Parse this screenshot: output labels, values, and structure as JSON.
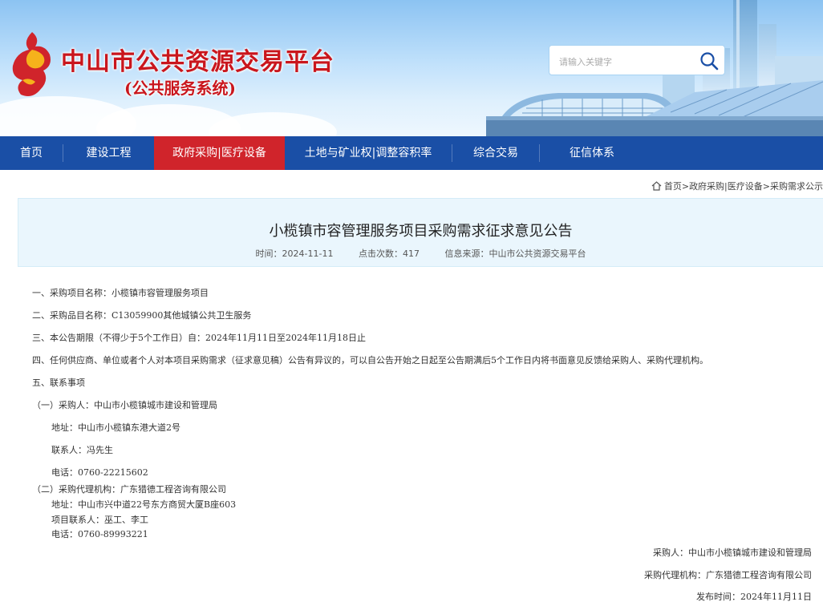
{
  "header": {
    "title": "中山市公共资源交易平台",
    "subtitle": "(公共服务系统)",
    "search_placeholder": "请输入关键字"
  },
  "nav": {
    "items": [
      {
        "label": "首页"
      },
      {
        "label": "建设工程"
      },
      {
        "label": "政府采购|医疗设备"
      },
      {
        "label": "土地与矿业权|调整容积率"
      },
      {
        "label": "综合交易"
      },
      {
        "label": "征信体系"
      }
    ],
    "active_index": 2
  },
  "breadcrumb": {
    "home": "首页",
    "sep": ">",
    "level1": "政府采购|医疗设备",
    "level2": "采购需求公示"
  },
  "article": {
    "title": "小榄镇市容管理服务项目采购需求征求意见公告",
    "time": "时间：2024-11-11",
    "clicks": "点击次数：417",
    "source": "信息来源：中山市公共资源交易平台"
  },
  "body": {
    "l1": "一、采购项目名称：小榄镇市容管理服务项目",
    "l2": "二、采购品目名称：C13059900其他城镇公共卫生服务",
    "l3": "三、本公告期限（不得少于5个工作日）自：2024年11月11日至2024年11月18日止",
    "l4": "四、任何供应商、单位或者个人对本项目采购需求（征求意见稿）公告有异议的，可以自公告开始之日起至公告期满后5个工作日内将书面意见反馈给采购人、采购代理机构。",
    "l5": "五、联系事项",
    "p1_head": "（一）采购人：中山市小榄镇城市建设和管理局",
    "p1_addr": "地址：中山市小榄镇东港大道2号",
    "p1_contact": "联系人：冯先生",
    "p1_tel": "电话：0760-22215602",
    "p2_head": "（二）采购代理机构：广东猎德工程咨询有限公司",
    "p2_addr": "地址：中山市兴中道22号东方商贸大厦B座603",
    "p2_contact": "项目联系人：巫工、李工",
    "p2_tel": "电话：0760-89993221"
  },
  "signature": {
    "buyer": "采购人：中山市小榄镇城市建设和管理局",
    "agent": "采购代理机构：广东猎德工程咨询有限公司",
    "date": "发布时间：2024年11月11日"
  },
  "colors": {
    "nav_bg": "#1a4fa6",
    "nav_active": "#d0242b",
    "title_red": "#c9161d",
    "title_box_bg": "#eaf6fd"
  }
}
